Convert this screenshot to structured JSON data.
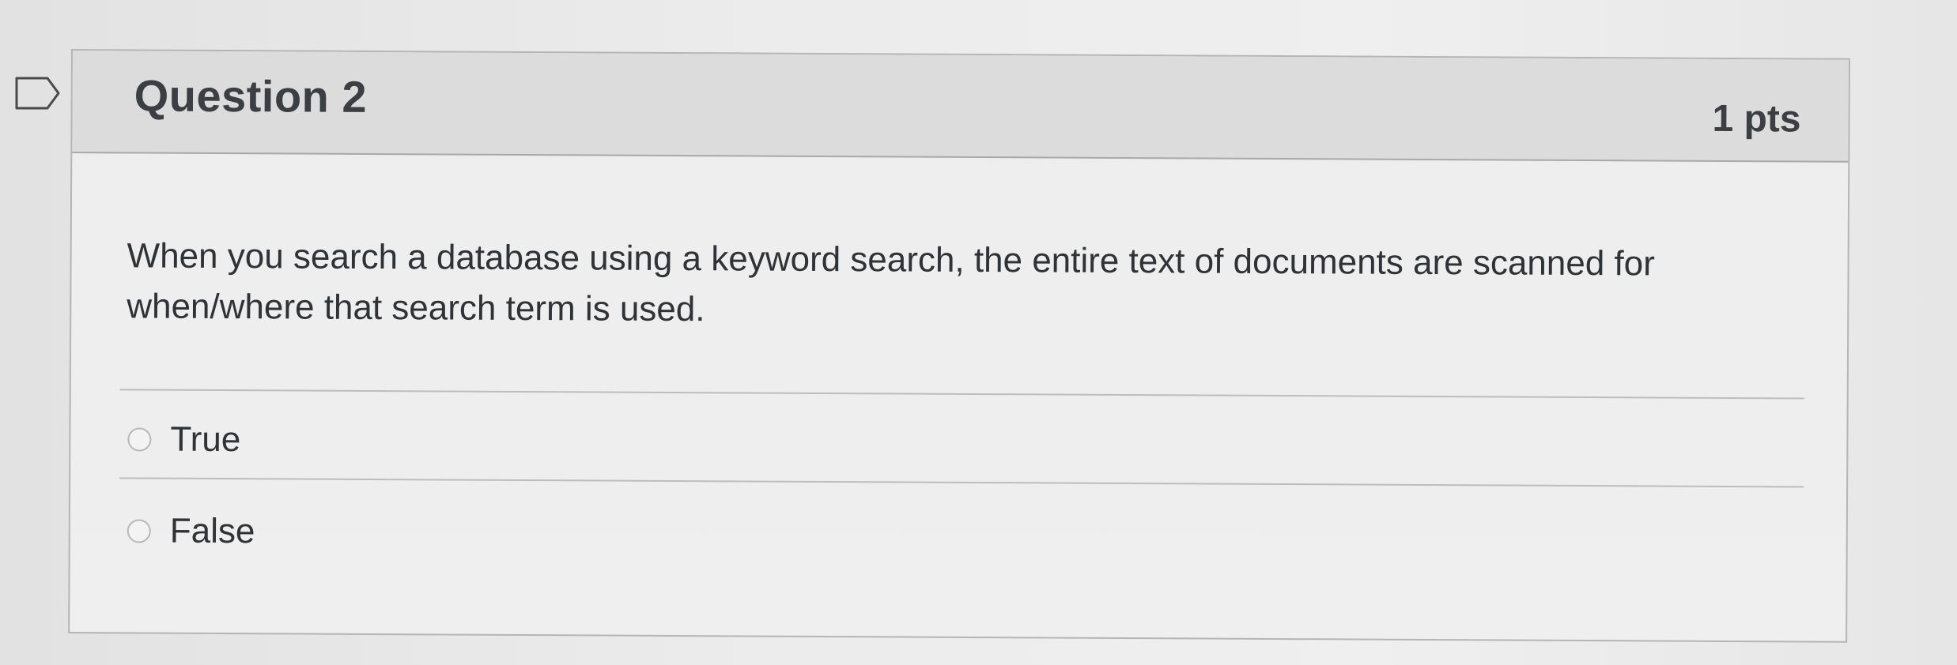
{
  "question": {
    "title": "Question 2",
    "points": "1 pts",
    "text": "When you search a database using a keyword search, the entire text of documents are scanned for when/where that search term is used."
  },
  "answers": [
    {
      "label": "True",
      "selected": false
    },
    {
      "label": "False",
      "selected": false
    }
  ],
  "icons": {
    "flag": "flag-bookmark-icon"
  },
  "colors": {
    "header_bg": "#dcdcdc",
    "card_bg": "#efefef",
    "text": "#2f3337",
    "border": "#b5b5b5"
  }
}
